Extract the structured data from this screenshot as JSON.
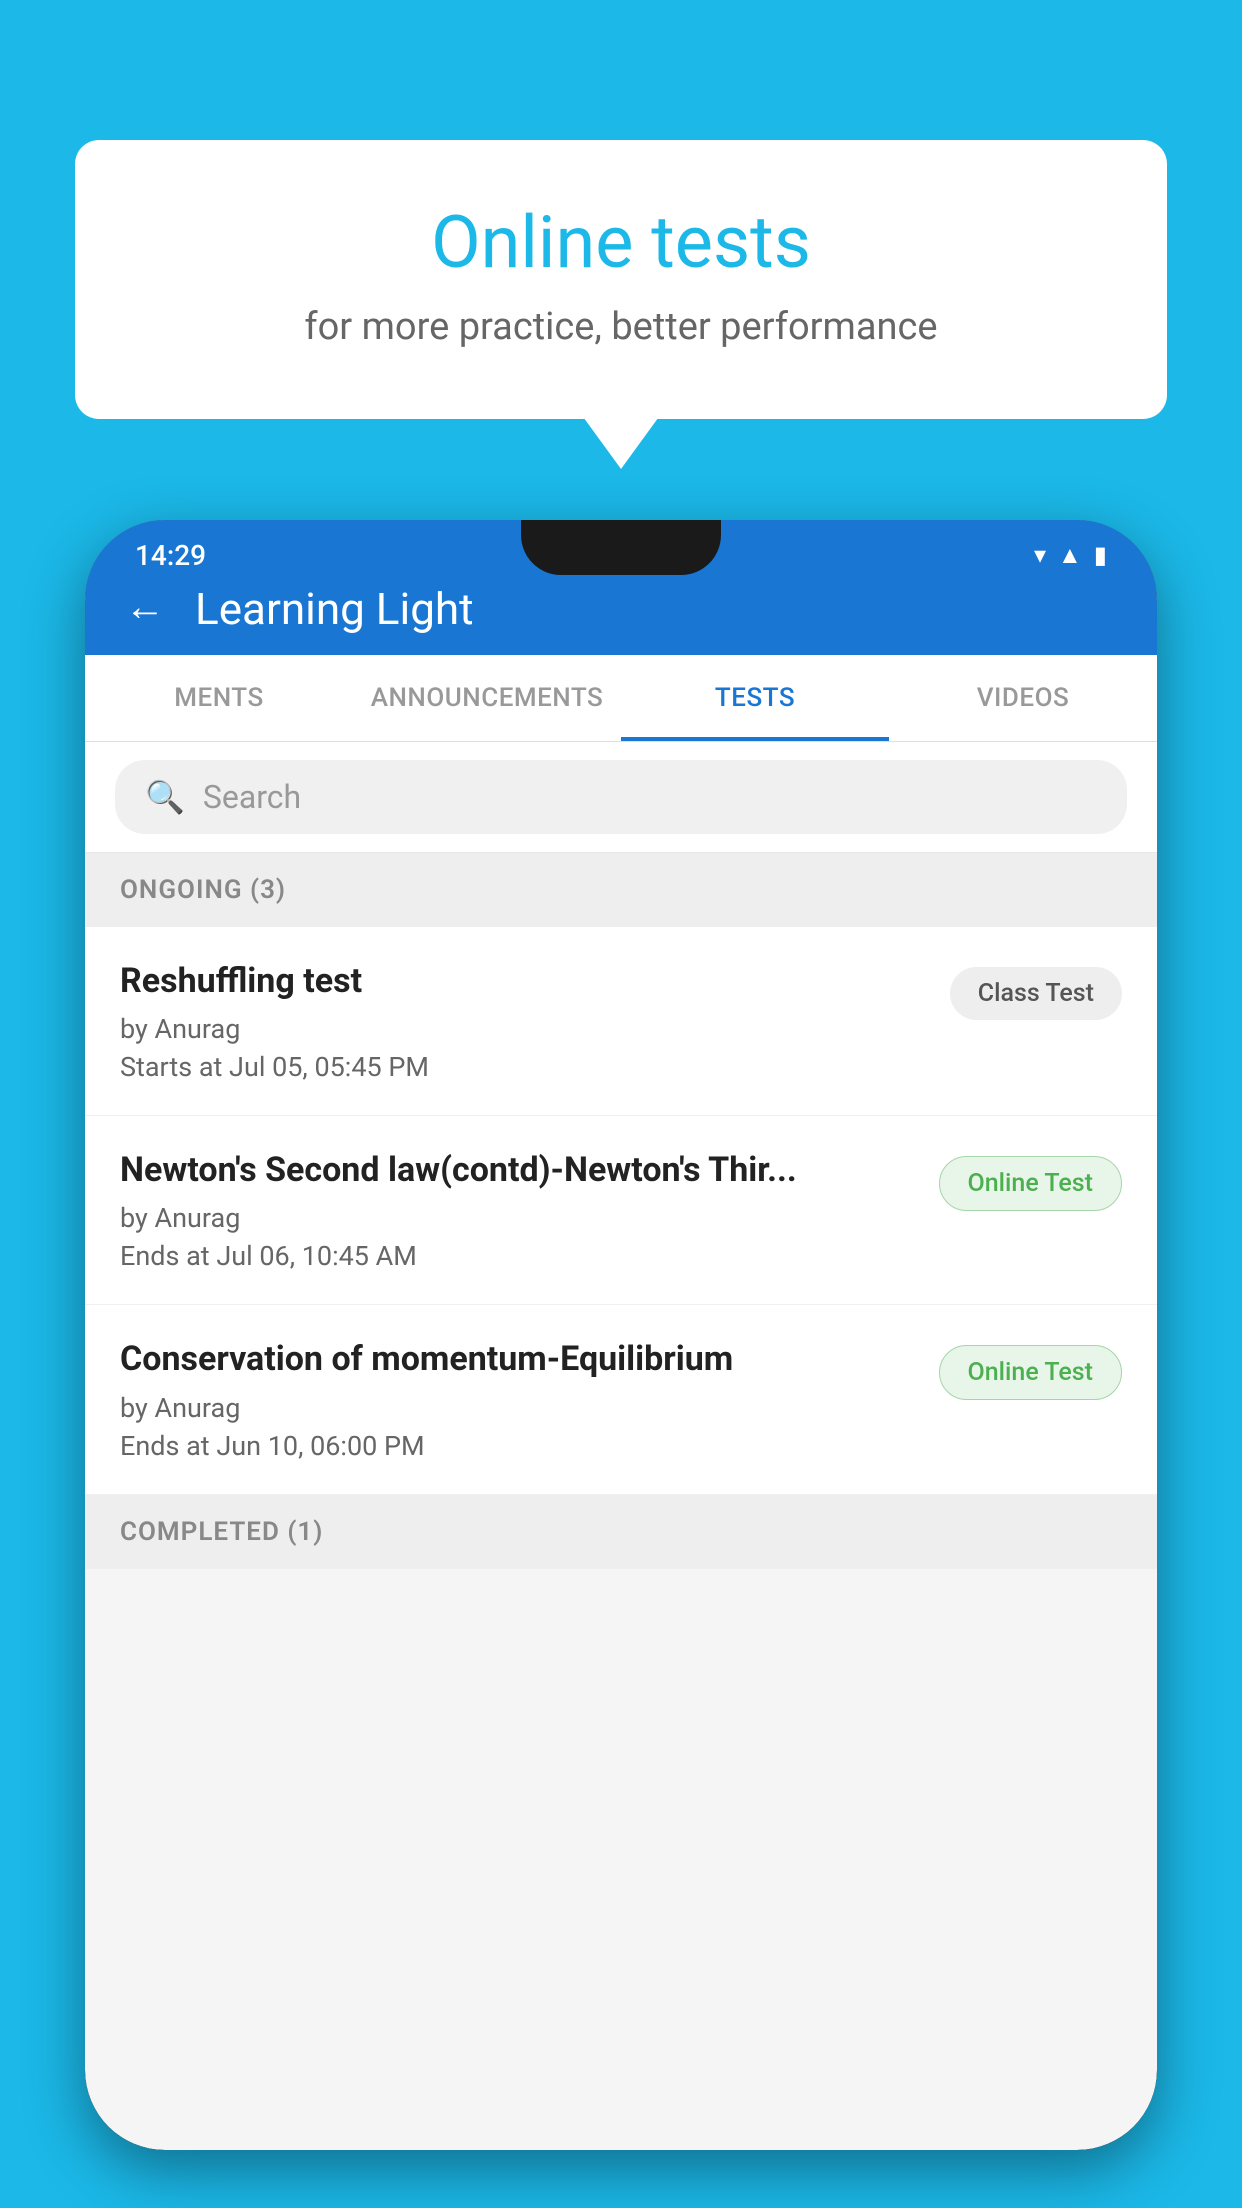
{
  "background": {
    "color": "#1BB8E8"
  },
  "speech_bubble": {
    "title": "Online tests",
    "subtitle": "for more practice, better performance"
  },
  "phone": {
    "status_bar": {
      "time": "14:29",
      "icons": [
        "wifi",
        "signal",
        "battery"
      ]
    },
    "app_bar": {
      "title": "Learning Light",
      "back_label": "←"
    },
    "tabs": [
      {
        "label": "MENTS",
        "active": false
      },
      {
        "label": "ANNOUNCEMENTS",
        "active": false
      },
      {
        "label": "TESTS",
        "active": true
      },
      {
        "label": "VIDEOS",
        "active": false
      }
    ],
    "search": {
      "placeholder": "Search"
    },
    "sections": [
      {
        "header": "ONGOING (3)",
        "tests": [
          {
            "title": "Reshuffling test",
            "author": "by Anurag",
            "time": "Starts at  Jul 05, 05:45 PM",
            "badge": "Class Test",
            "badge_type": "class"
          },
          {
            "title": "Newton's Second law(contd)-Newton's Thir...",
            "author": "by Anurag",
            "time": "Ends at  Jul 06, 10:45 AM",
            "badge": "Online Test",
            "badge_type": "online"
          },
          {
            "title": "Conservation of momentum-Equilibrium",
            "author": "by Anurag",
            "time": "Ends at  Jun 10, 06:00 PM",
            "badge": "Online Test",
            "badge_type": "online"
          }
        ]
      },
      {
        "header": "COMPLETED (1)",
        "tests": []
      }
    ]
  }
}
